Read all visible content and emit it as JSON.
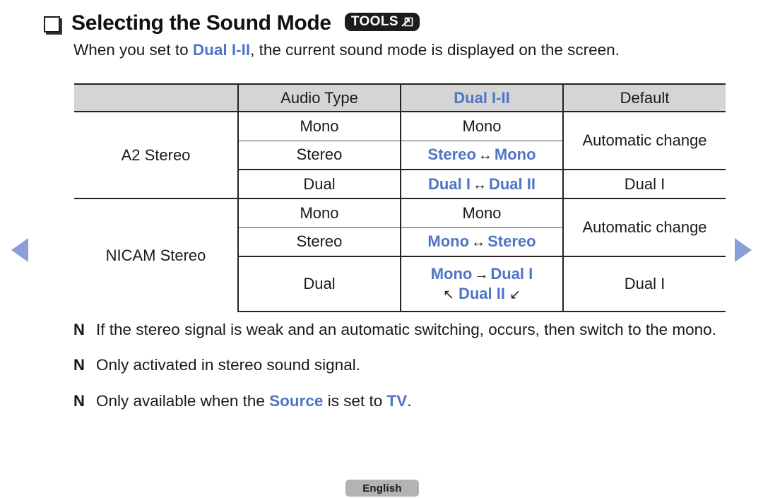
{
  "header": {
    "bullet_icon": "checkbox-icon",
    "title": "Selecting the Sound Mode",
    "tools_badge": {
      "label": "TOOLS",
      "icon": "arrow-into-box-icon"
    }
  },
  "intro": {
    "before": "When you set to ",
    "highlight": "Dual I-II",
    "after": ", the current sound mode is displayed on the screen."
  },
  "table": {
    "headers": {
      "col1": "",
      "col2": "Audio Type",
      "col3": "Dual I-II",
      "col4": "Default"
    },
    "groups": [
      {
        "name": "A2 Stereo",
        "rows": [
          {
            "audio_type": "Mono",
            "dual": "Mono",
            "arrow": "",
            "dual2": "",
            "default": "Automatic change"
          },
          {
            "audio_type": "Stereo",
            "dual": "Stereo",
            "arrow": "↔",
            "dual2": "Mono",
            "default": ""
          },
          {
            "audio_type": "Dual",
            "dual": "Dual I",
            "arrow": "↔",
            "dual2": "Dual II",
            "default": "Dual I"
          }
        ]
      },
      {
        "name": "NICAM Stereo",
        "rows": [
          {
            "audio_type": "Mono",
            "dual": "Mono",
            "arrow": "",
            "dual2": "",
            "default": "Automatic change"
          },
          {
            "audio_type": "Stereo",
            "dual": "Mono",
            "arrow": "↔",
            "dual2": "Stereo",
            "default": ""
          },
          {
            "audio_type": "Dual",
            "cycle_line1_a": "Mono",
            "cycle_arrow1": "→",
            "cycle_line1_b": "Dual I",
            "cycle_arrow_left": "↖",
            "cycle_line2": "Dual II",
            "cycle_arrow_right": "↙",
            "default": "Dual I"
          }
        ]
      }
    ]
  },
  "notes": [
    {
      "mark": "N",
      "text": "If the stereo signal is weak and an automatic switching, occurs, then switch to the mono."
    },
    {
      "mark": "N",
      "text": "Only activated in stereo sound signal."
    },
    {
      "mark": "N",
      "prefix": "Only available when the ",
      "highlight1": "Source",
      "middle": " is set to ",
      "highlight2": "TV",
      "suffix": "."
    }
  ],
  "footer": {
    "language": "English"
  },
  "nav": {
    "prev_icon": "triangle-left-icon",
    "next_icon": "triangle-right-icon"
  },
  "colors": {
    "accent_blue": "#4f75c6",
    "nav_blue": "#8b9ed8",
    "header_gray": "#d5d5d6",
    "chip_gray": "#b3b3b5"
  }
}
